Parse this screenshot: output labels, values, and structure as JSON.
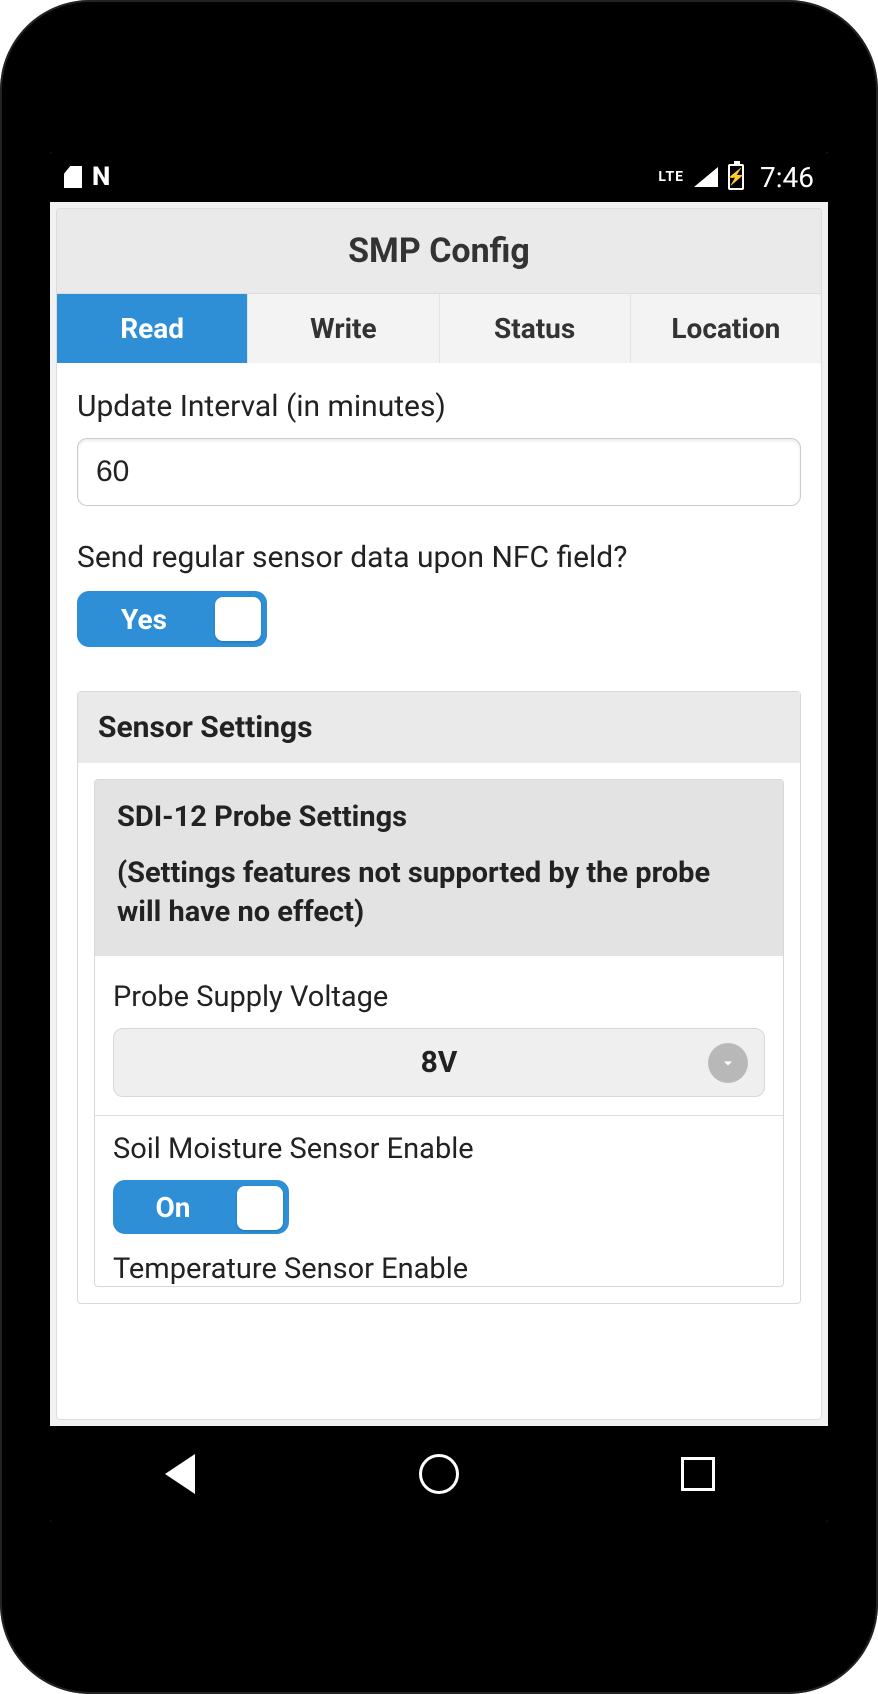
{
  "status_bar": {
    "network_type": "LTE",
    "time": "7:46"
  },
  "app": {
    "title": "SMP Config",
    "tabs": [
      "Read",
      "Write",
      "Status",
      "Location"
    ],
    "active_tab_index": 0
  },
  "form": {
    "update_interval": {
      "label": "Update Interval (in minutes)",
      "value": "60"
    },
    "nfc_send": {
      "question": "Send regular sensor data upon NFC field?",
      "toggle_label": "Yes",
      "enabled": true
    }
  },
  "sensor_section": {
    "title": "Sensor Settings",
    "probe": {
      "title": "SDI-12 Probe Settings",
      "note": "(Settings features not supported by the probe will have no effect)",
      "supply_voltage": {
        "label": "Probe Supply Voltage",
        "value": "8V"
      },
      "soil_moisture": {
        "label": "Soil Moisture Sensor Enable",
        "toggle_label": "On",
        "enabled": true
      },
      "temperature": {
        "label": "Temperature Sensor Enable"
      }
    }
  }
}
